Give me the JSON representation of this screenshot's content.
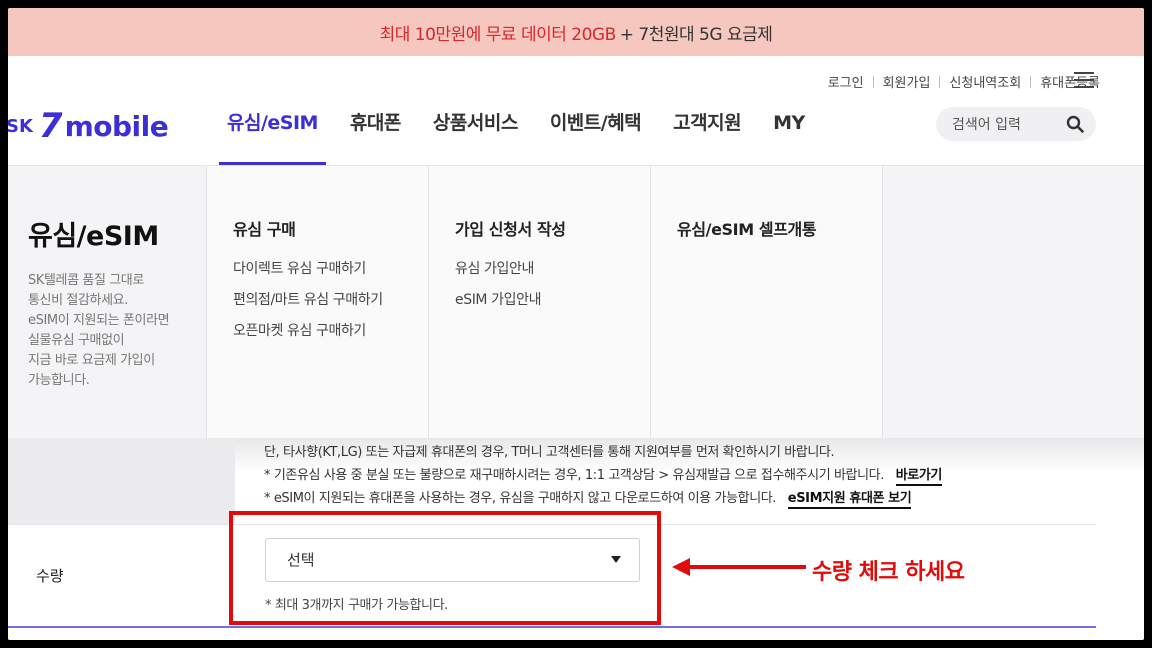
{
  "promo": {
    "highlight": "최대 10만원에 무료 데이터 20GB",
    "rest": "+ 7천원대 5G 요금제"
  },
  "util": {
    "login": "로그인",
    "join": "회원가입",
    "history": "신청내역조회",
    "phone_reg": "휴대폰등록"
  },
  "logo": {
    "sk": "SK",
    "seven": "7",
    "word": "mobile"
  },
  "gnb": {
    "items": [
      "유심/eSIM",
      "휴대폰",
      "상품서비스",
      "이벤트/혜택",
      "고객지원",
      "MY"
    ]
  },
  "search": {
    "placeholder": "검색어 입력"
  },
  "mega": {
    "title": "유심/eSIM",
    "desc": [
      "SK텔레콤 품질 그대로",
      "통신비 절감하세요.",
      "eSIM이 지원되는 폰이라면",
      "실물유심 구매없이",
      "지금 바로 요금제 가입이",
      "가능합니다."
    ],
    "columns": [
      {
        "heading": "유심 구매",
        "links": [
          "다이렉트 유심 구매하기",
          "편의점/마트 유심 구매하기",
          "오픈마켓 유심 구매하기"
        ]
      },
      {
        "heading": "가입 신청서 작성",
        "links": [
          "유심 가입안내",
          "eSIM 가입안내"
        ]
      },
      {
        "heading": "유심/eSIM 셀프개통",
        "links": []
      }
    ]
  },
  "notes": {
    "line1": "단, 타사향(KT,LG) 또는 자급제 휴대폰의 경우, T머니 고객센터를 통해 지원여부를 먼저 확인하시기 바랍니다.",
    "line2": "* 기존유심 사용 중 분실 또는 불량으로 재구매하시려는 경우, 1:1 고객상담 > 유심재발급 으로 접수해주시기 바랍니다.",
    "line2_link": "바로가기",
    "line3": "* eSIM이 지원되는 휴대폰을 사용하는 경우, 유심을 구매하지 않고 다운로드하여 이용 가능합니다.",
    "line3_link": "eSIM지원 휴대폰 보기"
  },
  "quantity": {
    "label": "수량",
    "select_value": "선택",
    "hint": "* 최대 3개까지 구매가 가능합니다."
  },
  "annotation": {
    "text": "수량 체크 하세요",
    "color": "#e10b0b"
  },
  "colors": {
    "brand": "#3d2fd6",
    "banner": "#f6c7bf",
    "banner_text": "#d8282b"
  }
}
